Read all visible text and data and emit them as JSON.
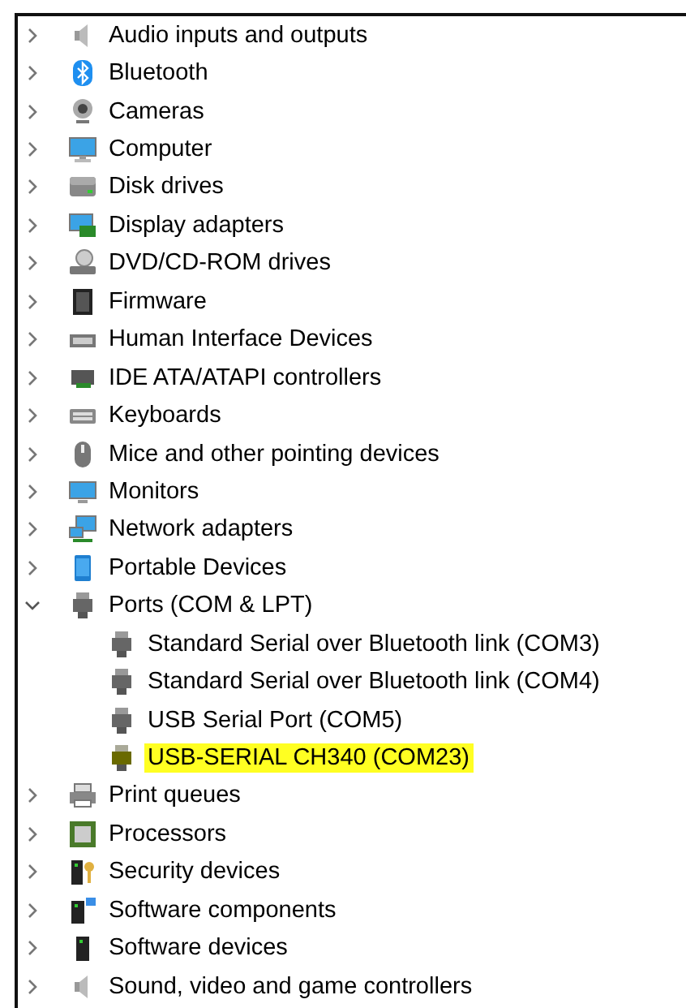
{
  "tree": [
    {
      "label": "Audio inputs and outputs",
      "expanded": false
    },
    {
      "label": "Bluetooth",
      "expanded": false
    },
    {
      "label": "Cameras",
      "expanded": false
    },
    {
      "label": "Computer",
      "expanded": false
    },
    {
      "label": "Disk drives",
      "expanded": false
    },
    {
      "label": "Display adapters",
      "expanded": false
    },
    {
      "label": "DVD/CD-ROM drives",
      "expanded": false
    },
    {
      "label": "Firmware",
      "expanded": false
    },
    {
      "label": "Human Interface Devices",
      "expanded": false
    },
    {
      "label": "IDE ATA/ATAPI controllers",
      "expanded": false
    },
    {
      "label": "Keyboards",
      "expanded": false
    },
    {
      "label": "Mice and other pointing devices",
      "expanded": false
    },
    {
      "label": "Monitors",
      "expanded": false
    },
    {
      "label": "Network adapters",
      "expanded": false
    },
    {
      "label": "Portable Devices",
      "expanded": false
    },
    {
      "label": "Ports (COM & LPT)",
      "expanded": true,
      "children": [
        {
          "label": "Standard Serial over Bluetooth link (COM3)",
          "highlighted": false
        },
        {
          "label": "Standard Serial over Bluetooth link (COM4)",
          "highlighted": false
        },
        {
          "label": "USB Serial Port (COM5)",
          "highlighted": false
        },
        {
          "label": "USB-SERIAL CH340 (COM23)",
          "highlighted": true
        }
      ]
    },
    {
      "label": "Print queues",
      "expanded": false
    },
    {
      "label": "Processors",
      "expanded": false
    },
    {
      "label": "Security devices",
      "expanded": false
    },
    {
      "label": "Software components",
      "expanded": false
    },
    {
      "label": "Software devices",
      "expanded": false
    },
    {
      "label": "Sound, video and game controllers",
      "expanded": false
    }
  ]
}
